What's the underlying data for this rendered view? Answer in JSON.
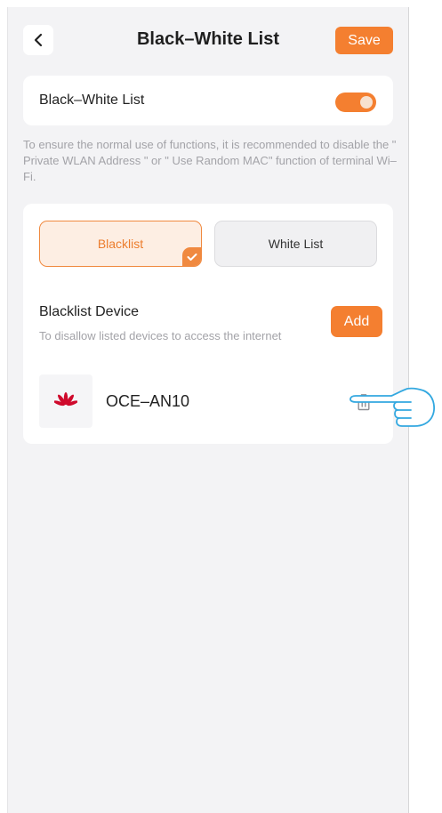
{
  "header": {
    "title": "Black–White List",
    "save_label": "Save"
  },
  "toggle_card": {
    "label": "Black–White List",
    "enabled": true
  },
  "hint": "To ensure the normal use of functions, it is recommended to disable the \" Private WLAN Address \" or \" Use Random MAC\" function of terminal Wi–Fi.",
  "tabs": [
    {
      "label": "Blacklist",
      "selected": true
    },
    {
      "label": "White List",
      "selected": false
    }
  ],
  "blacklist": {
    "title": "Blacklist Device",
    "subtitle": "To disallow listed devices to access the internet",
    "add_label": "Add",
    "devices": [
      {
        "name": "OCE–AN10",
        "icon": "huawei-logo-icon"
      }
    ]
  },
  "colors": {
    "accent": "#f47f30",
    "background": "#f3f3f5",
    "card": "#ffffff",
    "hint_text": "#a3a3a8"
  }
}
